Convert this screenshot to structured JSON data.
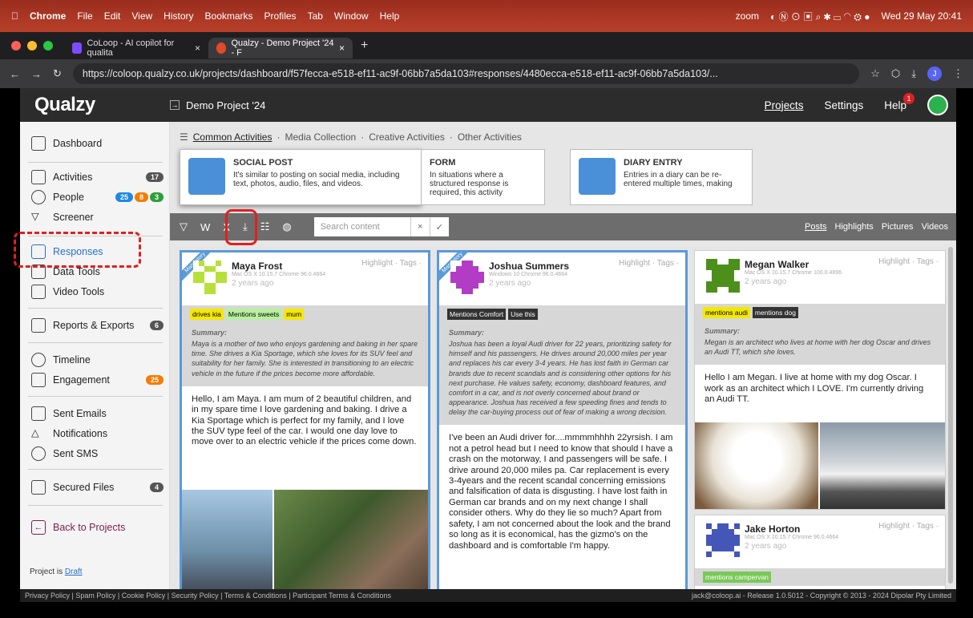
{
  "os_menu": {
    "app": "Chrome",
    "items": [
      "File",
      "Edit",
      "View",
      "History",
      "Bookmarks",
      "Profiles",
      "Tab",
      "Window",
      "Help"
    ],
    "zoom": "zoom",
    "clock": "Wed 29 May  20:41"
  },
  "browser": {
    "tabs": [
      {
        "title": "CoLoop - AI copilot for qualita",
        "close": "×"
      },
      {
        "title": "Qualzy - Demo Project '24 - F",
        "close": "×"
      }
    ],
    "new_tab": "+",
    "url": "https://coloop.qualzy.co.uk/projects/dashboard/f57fecca-e518-ef11-ac9f-06bb7a5da103#responses/4480ecca-e518-ef11-ac9f-06bb7a5da103/...",
    "profile_initial": "J"
  },
  "topnav": {
    "logo": "Qualzy",
    "project": "Demo Project '24",
    "projects": "Projects",
    "settings": "Settings",
    "help": "Help",
    "help_badge": "1"
  },
  "sidebar": {
    "dashboard": "Dashboard",
    "activities": "Activities",
    "activities_count": "17",
    "people": "People",
    "people_counts": [
      "25",
      "8",
      "3"
    ],
    "screener": "Screener",
    "responses": "Responses",
    "data_tools": "Data Tools",
    "video_tools": "Video Tools",
    "reports": "Reports & Exports",
    "reports_count": "6",
    "timeline": "Timeline",
    "engagement": "Engagement",
    "engagement_count": "25",
    "sent_emails": "Sent Emails",
    "notifications": "Notifications",
    "sent_sms": "Sent SMS",
    "secured_files": "Secured Files",
    "secured_count": "4",
    "back": "Back to Projects",
    "status_prefix": "Project is",
    "status": "Draft"
  },
  "activity_tabs": {
    "common": "Common Activities",
    "media": "Media Collection",
    "creative": "Creative Activities",
    "other": "Other Activities",
    "sep": "·"
  },
  "activity_cards": [
    {
      "title": "SOCIAL POST",
      "desc": "It's similar to posting on social media, including text, photos, audio, files, and videos."
    },
    {
      "title": "FORM",
      "desc": "In situations where a structured response is required, this activity"
    },
    {
      "title": "DIARY ENTRY",
      "desc": "Entries in a diary can be re-entered multiple times, making"
    }
  ],
  "toolbar": {
    "search_placeholder": "Search content",
    "clear": "×",
    "confirm": "✓",
    "views": [
      "Posts",
      "Highlights",
      "Pictures",
      "Videos"
    ]
  },
  "posts": [
    {
      "name": "Maya Frost",
      "meta": "Mac OS X 10.15.7 Chrome 96.0.4664",
      "ago": "2 years ago",
      "mandatory": "Mandatory",
      "actions": "Highlight · Tags ·",
      "tags": [
        "drives kia",
        "Mentions sweets",
        "mum"
      ],
      "summary_label": "Summary:",
      "summary": "Maya is a mother of two who enjoys gardening and baking in her spare time. She drives a Kia Sportage, which she loves for its SUV feel and suitability for her family. She is interested in transitioning to an electric vehicle in the future if the prices become more affordable.",
      "text": "Hello, I am Maya. I am mum of 2 beautiful children, and in my spare time I love gardening and baking. I drive a Kia Sportage which is perfect for my family, and I love the SUV type feel of the car. I would one day love to move over to an electric vehicle if the prices come down."
    },
    {
      "name": "Joshua Summers",
      "meta": "Windows 10 Chrome 96.0.4664",
      "ago": "2 years ago",
      "mandatory": "Mandatory",
      "actions": "Highlight · Tags ·",
      "tags": [
        "Mentions Comfort",
        "Use this"
      ],
      "summary_label": "Summary:",
      "summary": "Joshua has been a loyal Audi driver for 22 years, prioritizing safety for himself and his passengers. He drives around 20,000 miles per year and replaces his car every 3-4 years. He has lost faith in German car brands due to recent scandals and is considering other options for his next purchase. He values safety, economy, dashboard features, and comfort in a car, and is not overly concerned about brand or appearance. Joshua has received a few speeding fines and tends to delay the car-buying process out of fear of making a wrong decision.",
      "text": "I've been an Audi driver for....mmmmhhhh 22yrsish. I am not a petrol head but I need to know that should I have a crash on the motorway, I and passengers will be safe. I drive around 20,000 miles pa. Car replacement is every 3-4years and the recent scandal concerning emissions and falsification of data is disgusting. I have lost faith in German car brands and on my next change I shall consider others. Why do they lie so much? Apart from safety, I am not concerned about the look and the brand so long as it is economical, has the gizmo's on the dashboard and is comfortable I'm happy."
    },
    {
      "name": "Megan Walker",
      "meta": "Mac OS X 10.15.7 Chrome 100.0.4896",
      "ago": "2 years ago",
      "actions": "Highlight · Tags ·",
      "tags": [
        "mentions audi",
        "mentions dog"
      ],
      "summary_label": "Summary:",
      "summary": "Megan is an architect who lives at home with her dog Oscar and drives an Audi TT, which she loves.",
      "text": "Hello I am Megan. I live at home with my dog Oscar. I work as an architect which I LOVE. I'm currently driving an Audi TT."
    },
    {
      "name": "Jake Horton",
      "meta": "Mac OS X 10.15.7 Chrome 96.0.4664",
      "ago": "2 years ago",
      "actions": "Highlight · Tags ·",
      "tags": [
        "mentions campervan"
      ]
    }
  ],
  "footer": {
    "links": "Privacy Policy  |  Spam Policy  |  Cookie Policy  |  Security Policy  |  Terms & Conditions  |  Participant Terms & Conditions",
    "right": "jack@coloop.ai - Release 1.0.5012 - Copyright © 2013 - 2024 Dipolar Pty Limited"
  },
  "colors": {
    "accent": "#5a9ad8",
    "tag_yellow": "#f5e800",
    "tag_green": "#b8f0a0",
    "tag_dark": "#333333",
    "tag_campervan": "#7ac85a"
  }
}
